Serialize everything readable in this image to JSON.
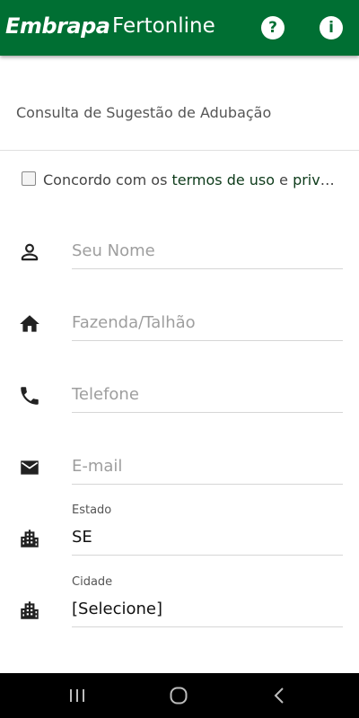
{
  "appbar": {
    "logo_text": "Embrapa",
    "title": "Fertonline",
    "help_icon": "?",
    "info_icon": "i",
    "color": "#006f33"
  },
  "main": {
    "section_title": "Consulta de Sugestão de Adubação",
    "terms": {
      "prefix": "Concordo com os ",
      "link1": "termos de uso",
      "middle": " e ",
      "link2": "privacidade",
      "checked": false
    },
    "fields": [
      {
        "icon": "person-icon",
        "placeholder": "Seu Nome"
      },
      {
        "icon": "home-icon",
        "placeholder": "Fazenda/Talhão"
      },
      {
        "icon": "phone-icon",
        "placeholder": "Telefone"
      },
      {
        "icon": "email-icon",
        "placeholder": "E-mail"
      },
      {
        "icon": "city-icon",
        "label": "Estado",
        "value": "SE"
      },
      {
        "icon": "city-icon",
        "label": "Cidade",
        "value": "[Selecione]"
      }
    ]
  },
  "navbar": {
    "recents_icon": "recents-icon",
    "home_icon": "home-nav-icon",
    "back_icon": "back-icon"
  }
}
